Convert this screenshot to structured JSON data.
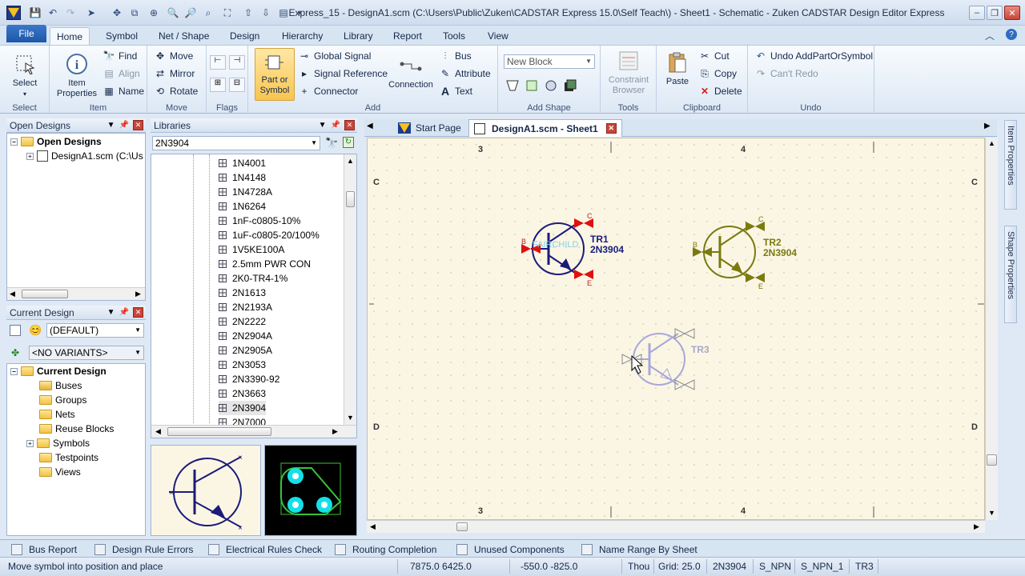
{
  "window": {
    "title": "Express_15 - DesignA1.scm (C:\\Users\\Public\\Zuken\\CADSTAR Express 15.0\\Self Teach\\) - Sheet1 - Schematic - Zuken CADSTAR Design Editor Express",
    "controls": {
      "minimize": "–",
      "restore": "❐",
      "close": "✕"
    }
  },
  "menu_tabs": [
    "File",
    "Home",
    "Symbol",
    "Net / Shape",
    "Design",
    "Hierarchy",
    "Library",
    "Report",
    "Tools",
    "View"
  ],
  "active_tab": "Home",
  "ribbon": {
    "select": {
      "label": "Select",
      "group": "Select"
    },
    "item": {
      "item_properties": "Item\nProperties",
      "find": "Find",
      "align": "Align",
      "name": "Name",
      "group": "Item"
    },
    "move": {
      "move": "Move",
      "mirror": "Mirror",
      "rotate": "Rotate",
      "group": "Move"
    },
    "flags": {
      "group": "Flags"
    },
    "add": {
      "part_or_symbol": "Part or\nSymbol",
      "global_signal": "Global Signal",
      "signal_reference": "Signal Reference",
      "connector": "Connector",
      "connection": "Connection",
      "bus": "Bus",
      "attribute": "Attribute",
      "text": "Text",
      "group": "Add"
    },
    "add_shape": {
      "combo_value": "New Block",
      "group": "Add Shape"
    },
    "tools": {
      "constraint_browser": "Constraint\nBrowser",
      "group": "Tools"
    },
    "clipboard": {
      "paste": "Paste",
      "cut": "Cut",
      "copy": "Copy",
      "delete": "Delete",
      "group": "Clipboard"
    },
    "undo": {
      "undo": "Undo AddPartOrSymbol",
      "redo": "Can't Redo",
      "group": "Undo"
    }
  },
  "open_designs": {
    "title": "Open Designs",
    "root": "Open Designs",
    "items": [
      "DesignA1.scm (C:\\Us"
    ]
  },
  "libraries": {
    "title": "Libraries",
    "search_value": "2N3904",
    "items": [
      "1N4001",
      "1N4148",
      "1N4728A",
      "1N6264",
      "1nF-c0805-10%",
      "1uF-c0805-20/100%",
      "1V5KE100A",
      "2.5mm PWR CON",
      "2K0-TR4-1%",
      "2N1613",
      "2N2193A",
      "2N2222",
      "2N2904A",
      "2N2905A",
      "2N3053",
      "2N3390-92",
      "2N3663",
      "2N3904",
      "2N7000"
    ],
    "selected": "2N3904"
  },
  "current_design": {
    "title": "Current Design",
    "variant_default": "(DEFAULT)",
    "variant_none": "<NO VARIANTS>",
    "root": "Current Design",
    "items": [
      "Buses",
      "Groups",
      "Nets",
      "Reuse Blocks",
      "Symbols",
      "Testpoints",
      "Views"
    ]
  },
  "doc_tabs": {
    "start_page": "Start Page",
    "sheet": "DesignA1.scm - Sheet1"
  },
  "schematic": {
    "col_labels": [
      "3",
      "4"
    ],
    "row_labels": [
      "C",
      "D"
    ],
    "tr1": {
      "ref": "TR1",
      "part": "2N3904",
      "pin_b": "B",
      "pin_c": "C",
      "pin_e": "E",
      "watermark": "FAIRCHILD"
    },
    "tr2": {
      "ref": "TR2",
      "part": "2N3904",
      "pin_b": "B",
      "pin_c": "C",
      "pin_e": "E"
    },
    "tr3": {
      "ref": "TR3"
    }
  },
  "side_tabs": [
    "Item Properties",
    "Shape Properties"
  ],
  "bottom_tabs": [
    "Bus Report",
    "Design Rule Errors",
    "Electrical Rules Check",
    "Routing Completion",
    "Unused Components",
    "Name Range By Sheet"
  ],
  "status": {
    "message": "Move symbol into position and place",
    "coords": "7875.0  6425.0",
    "delta": "-550.0   -825.0",
    "units": "Thou",
    "grid": "Grid: 25.0",
    "part": "2N3904",
    "symbol": "S_NPN",
    "symbol_variant": "S_NPN_1",
    "ref": "TR3"
  },
  "colors": {
    "accent": "#1c57a8",
    "canvas": "#fbf6e4",
    "tr1": "#1b1b7a",
    "tr2": "#7a7a10",
    "pin_red": "#e01010"
  }
}
